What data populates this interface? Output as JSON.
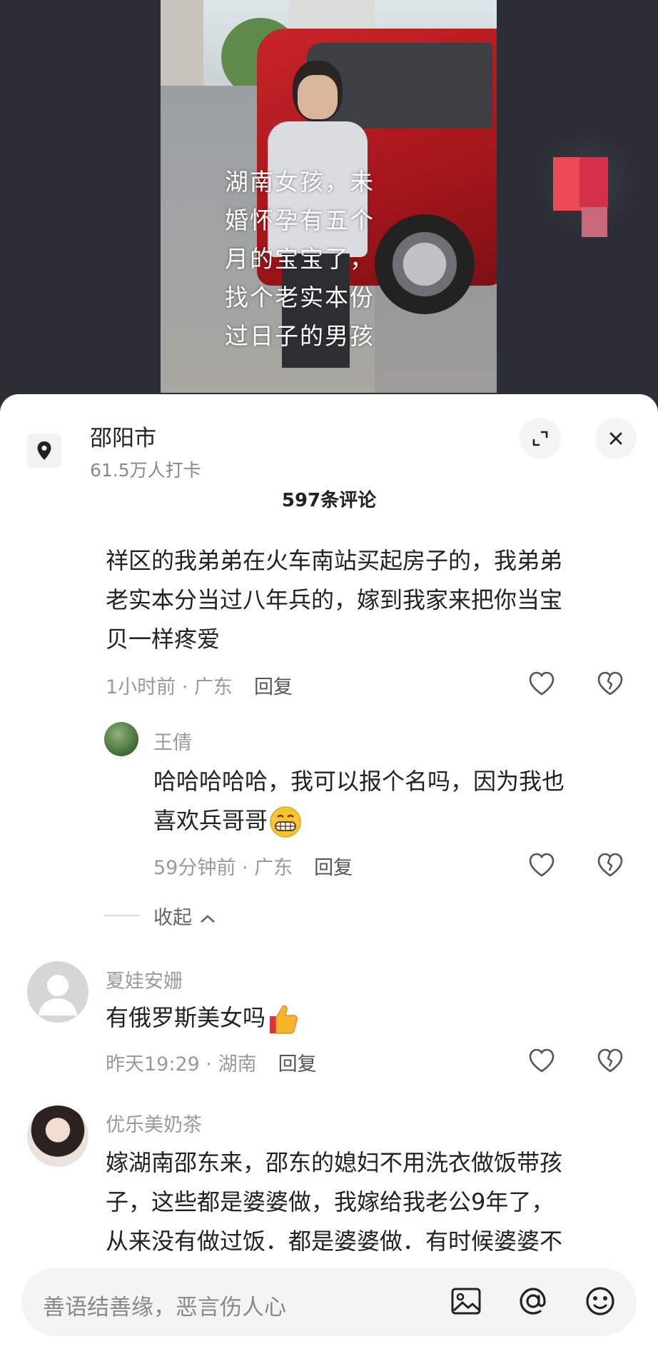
{
  "video": {
    "caption": "湖南女孩，未\n婚怀孕有五个\n月的宝宝了，\n找个老实本份\n过日子的男孩"
  },
  "header": {
    "location_name": "邵阳市",
    "location_checkins": "61.5万人打卡",
    "comment_count": "597条评论"
  },
  "comments": [
    {
      "text_lines": [
        "祥区的我弟弟在火车南站买起房子的，我弟弟",
        "老实本分当过八年兵的，嫁到我家来把你当宝",
        "贝一样疼爱"
      ],
      "time": "1小时前",
      "region": "广东",
      "reply_label": "回复"
    },
    {
      "username": "王倩",
      "text_lines": [
        "哈哈哈哈哈，我可以报个名吗，因为我也",
        "喜欢兵哥哥"
      ],
      "time": "59分钟前",
      "region": "广东",
      "reply_label": "回复"
    },
    {
      "username": "夏娃安姗",
      "text": "有俄罗斯美女吗",
      "time": "昨天19:29",
      "region": "湖南",
      "reply_label": "回复"
    },
    {
      "username": "优乐美奶茶",
      "text_lines": [
        "嫁湖南邵东来，邵东的媳妇不用洗衣做饭带孩",
        "子，这些都是婆婆做，我嫁给我老公9年了，",
        "从来没有做过饭．都是婆婆做．有时候婆婆不"
      ]
    }
  ],
  "collapse_label": "收起",
  "input": {
    "placeholder": "善语结善缘，恶言伤人心"
  },
  "icons": {
    "location": "location-pin-icon",
    "expand": "expand-icon",
    "close": "close-icon",
    "like": "heart-icon",
    "dislike": "broken-heart-icon",
    "image": "image-icon",
    "mention": "at-icon",
    "emoji": "emoji-icon"
  },
  "colors": {
    "sheet_bg": "#ffffff",
    "video_bg": "#2c2e35",
    "meta_text": "#9a9a9a"
  }
}
